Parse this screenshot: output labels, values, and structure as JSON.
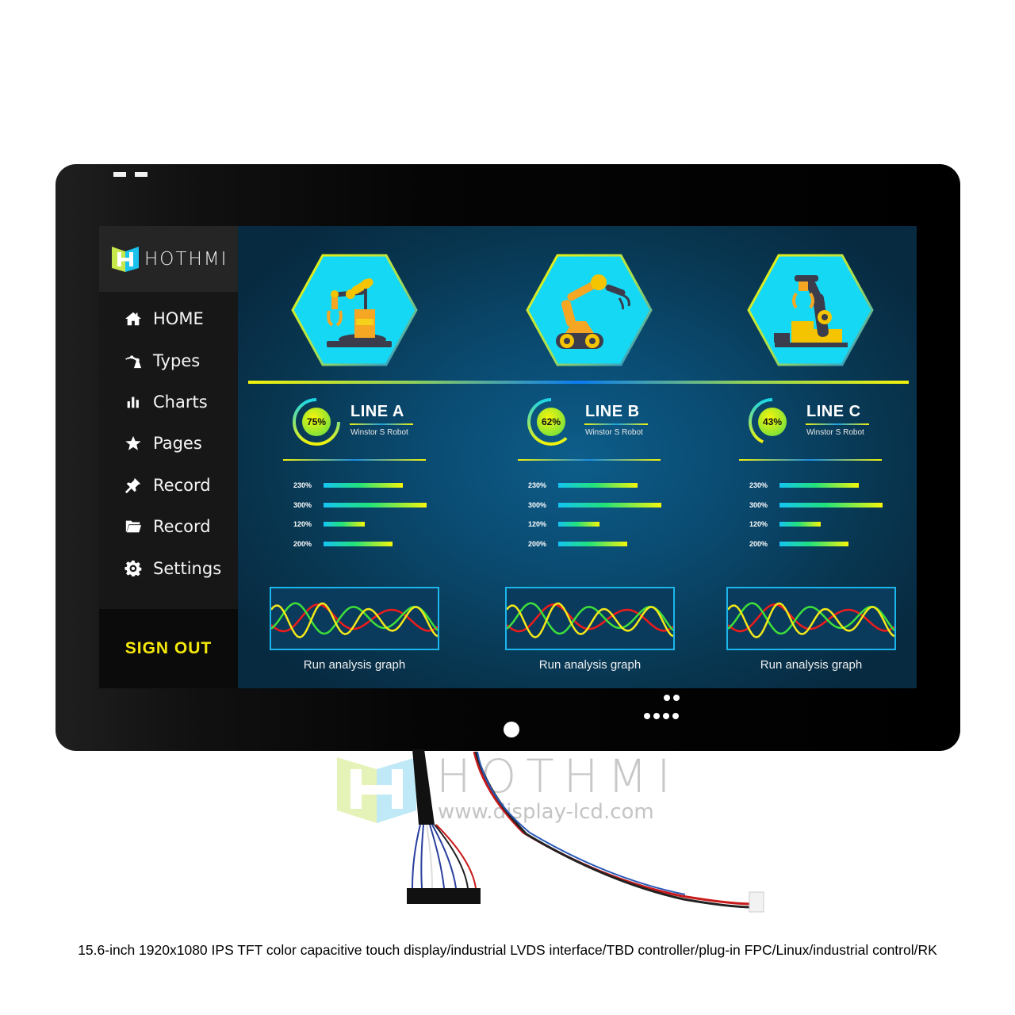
{
  "brand": {
    "name": "HOTHMI",
    "colors": {
      "lime": "#c6e84a",
      "cyan": "#19c3ee",
      "accent_yellow": "#f6e90a"
    }
  },
  "sidebar": {
    "items": [
      {
        "label": "HOME",
        "icon": "home-icon"
      },
      {
        "label": "Types",
        "icon": "robot-arm-icon"
      },
      {
        "label": "Charts",
        "icon": "bar-chart-icon"
      },
      {
        "label": "Pages",
        "icon": "star-icon"
      },
      {
        "label": "Record",
        "icon": "pin-icon"
      },
      {
        "label": "Record",
        "icon": "folder-icon"
      },
      {
        "label": "Settings",
        "icon": "gear-icon"
      }
    ],
    "sign_out": "SIGN OUT"
  },
  "main": {
    "robots": [
      {
        "icon": "industrial-robot-arm-icon"
      },
      {
        "icon": "tracked-robot-arm-icon"
      },
      {
        "icon": "gripper-robot-arm-icon"
      }
    ],
    "lines": [
      {
        "title": "LINE A",
        "subtitle": "Winstor S Robot",
        "gauge_label": "75%",
        "gauge_value": 75,
        "bars": [
          {
            "label": "230%",
            "value": 230
          },
          {
            "label": "300%",
            "value": 300
          },
          {
            "label": "120%",
            "value": 120
          },
          {
            "label": "200%",
            "value": 200
          }
        ],
        "graph_label": "Run analysis graph"
      },
      {
        "title": "LINE B",
        "subtitle": "Winstor S Robot",
        "gauge_label": "62%",
        "gauge_value": 62,
        "bars": [
          {
            "label": "230%",
            "value": 230
          },
          {
            "label": "300%",
            "value": 300
          },
          {
            "label": "120%",
            "value": 120
          },
          {
            "label": "200%",
            "value": 200
          }
        ],
        "graph_label": "Run analysis graph"
      },
      {
        "title": "LINE C",
        "subtitle": "Winstor S Robot",
        "gauge_label": "43%",
        "gauge_value": 43,
        "bars": [
          {
            "label": "230%",
            "value": 230
          },
          {
            "label": "300%",
            "value": 300
          },
          {
            "label": "120%",
            "value": 120
          },
          {
            "label": "200%",
            "value": 200
          }
        ],
        "graph_label": "Run analysis graph"
      }
    ],
    "bar_max": 300,
    "graph_series_colors": [
      "#ee1c1c",
      "#3ee03a",
      "#f4e81a"
    ]
  },
  "watermark": {
    "brand": "HOTHMI",
    "url": "www.display-lcd.com"
  },
  "caption": "15.6-inch 1920x1080 IPS TFT color capacitive touch display/industrial LVDS interface/TBD controller/plug-in FPC/Linux/industrial control/RK"
}
